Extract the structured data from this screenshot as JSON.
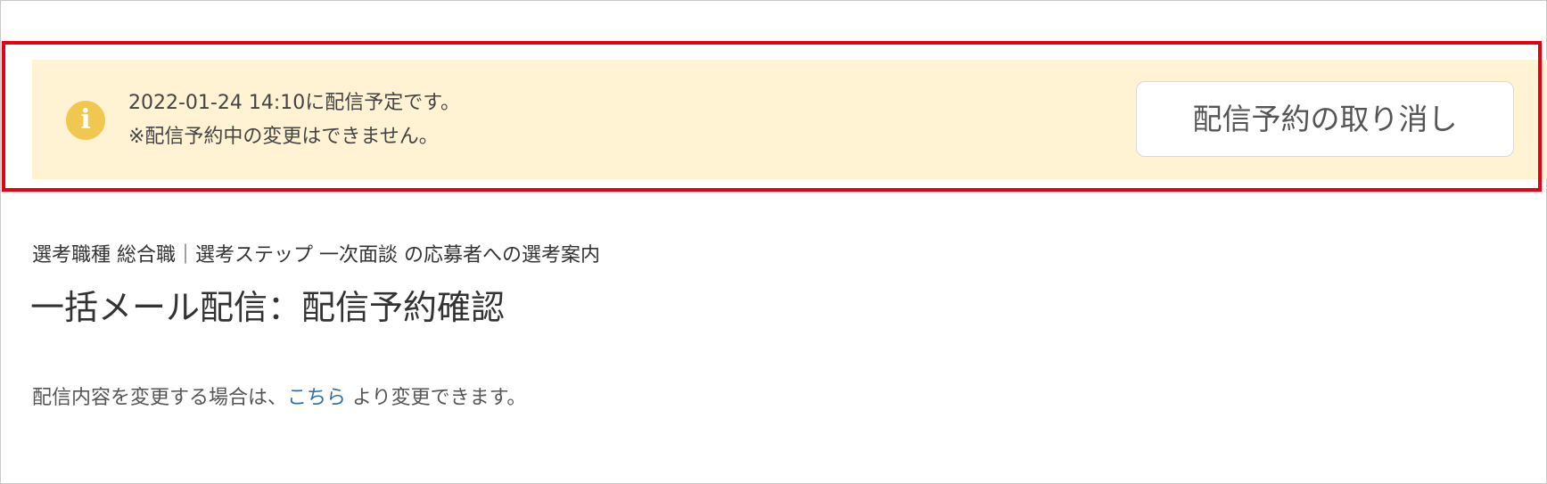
{
  "notice": {
    "icon": "info-icon",
    "icon_glyph": "i",
    "line1": "2022-01-24 14:10に配信予定です。",
    "line2": "※配信予約中の変更はできません。",
    "cancel_button_label": "配信予約の取り消し"
  },
  "header": {
    "subtitle": "選考職種 総合職｜選考ステップ 一次面談 の応募者への選考案内",
    "title": "一括メール配信：配信予約確認"
  },
  "description": {
    "prefix": "配信内容を変更する場合は、",
    "link_label": "こちら",
    "suffix": " より変更できます。"
  },
  "colors": {
    "highlight_border": "#e60012",
    "banner_background": "#fff3d4",
    "icon_background": "#f0c74f",
    "link": "#2f6fa8"
  }
}
